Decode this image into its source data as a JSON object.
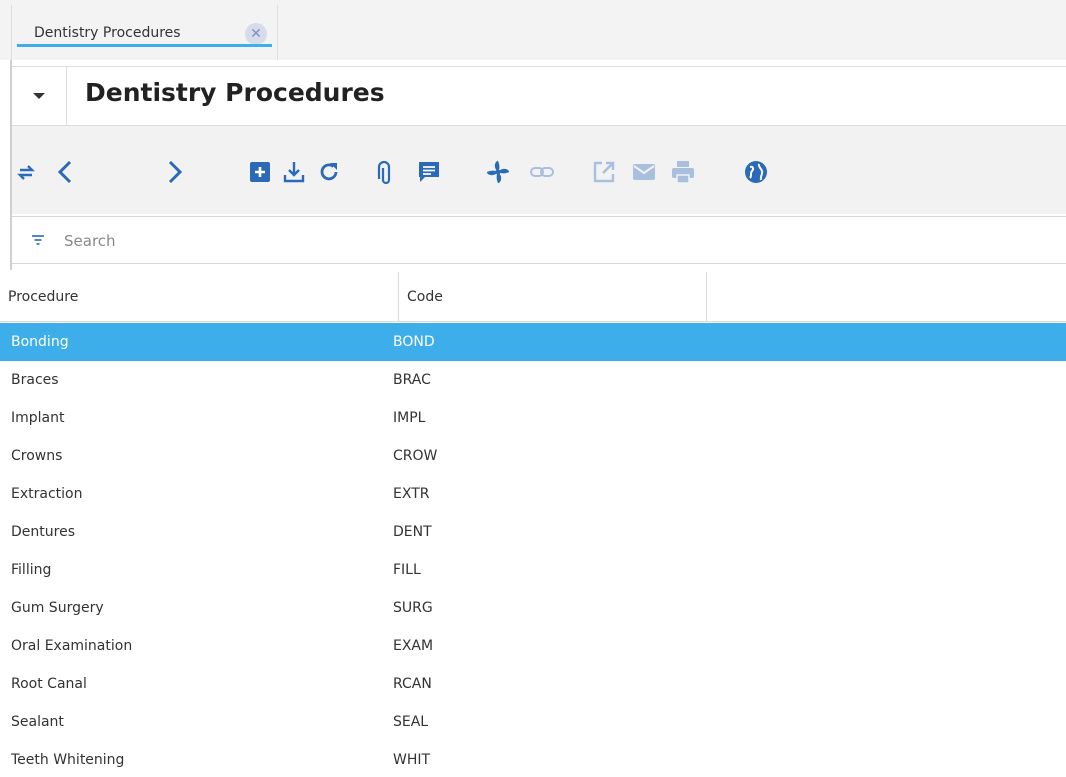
{
  "tab": {
    "label": "Dentistry Procedures",
    "close_icon": "close-icon"
  },
  "page": {
    "title": "Dentistry Procedures"
  },
  "toolbar": {
    "accent_color": "#2a6ab8",
    "disabled_color": "#a8bfdd",
    "icons": [
      "switch-icon",
      "previous-icon",
      "next-icon",
      "new-record-icon",
      "download-icon",
      "refresh-icon",
      "attachment-icon",
      "comments-icon",
      "workflow-icon",
      "link-icon",
      "zoom-across-icon",
      "email-icon",
      "print-icon",
      "web-icon"
    ]
  },
  "search": {
    "placeholder": "Search",
    "value": ""
  },
  "grid": {
    "columns": [
      "Procedure",
      "Code"
    ],
    "selected_color": "#3daee9",
    "rows": [
      {
        "procedure": "Bonding",
        "code": "BOND",
        "selected": true
      },
      {
        "procedure": "Braces",
        "code": "BRAC"
      },
      {
        "procedure": "Implant",
        "code": "IMPL"
      },
      {
        "procedure": "Crowns",
        "code": "CROW"
      },
      {
        "procedure": "Extraction",
        "code": "EXTR"
      },
      {
        "procedure": "Dentures",
        "code": "DENT"
      },
      {
        "procedure": "Filling",
        "code": "FILL"
      },
      {
        "procedure": "Gum Surgery",
        "code": "SURG"
      },
      {
        "procedure": "Oral Examination",
        "code": "EXAM"
      },
      {
        "procedure": "Root Canal",
        "code": "RCAN"
      },
      {
        "procedure": "Sealant",
        "code": "SEAL"
      },
      {
        "procedure": "Teeth Whitening",
        "code": "WHIT"
      }
    ]
  }
}
